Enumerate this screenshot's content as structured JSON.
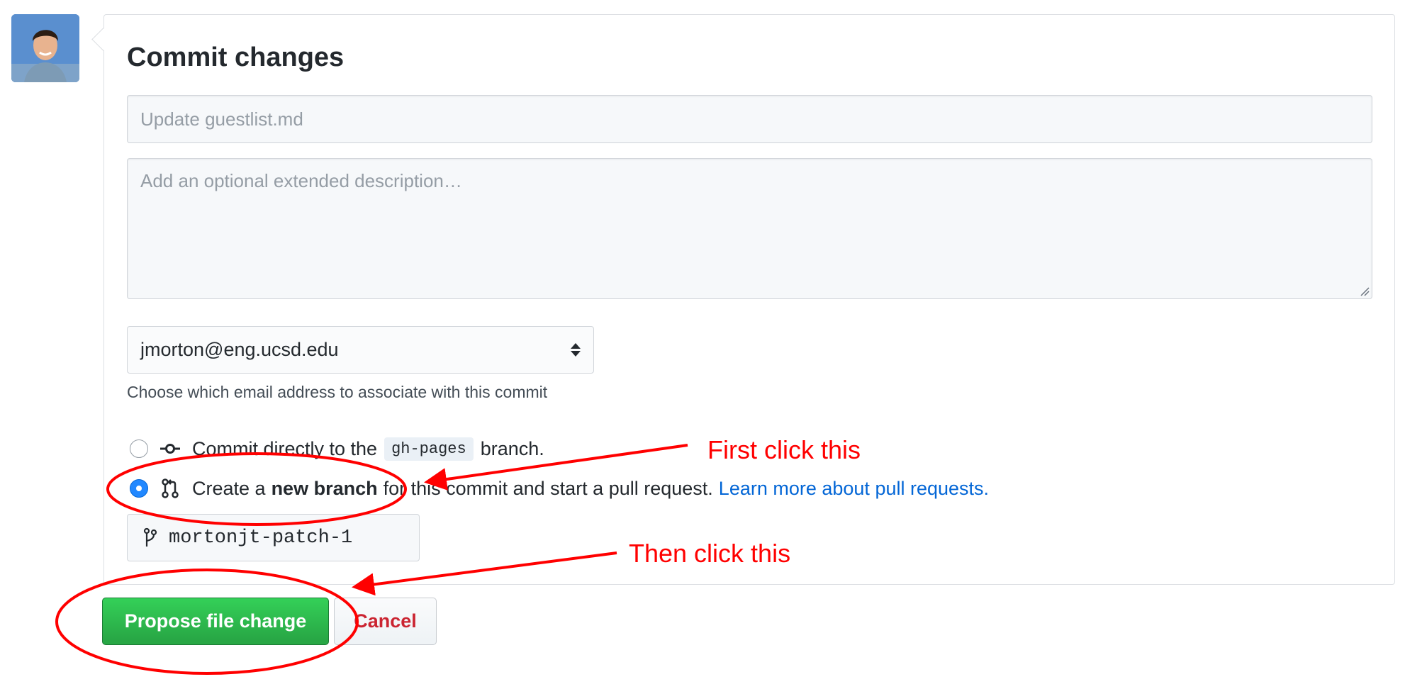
{
  "commit_form": {
    "title": "Commit changes",
    "summary_placeholder": "Update guestlist.md",
    "description_placeholder": "Add an optional extended description…",
    "email_selected": "jmorton@eng.ucsd.edu",
    "email_note": "Choose which email address to associate with this commit",
    "options": {
      "direct": {
        "prefix": "Commit directly to the",
        "branch": "gh-pages",
        "suffix": "branch.",
        "selected": false
      },
      "new_branch": {
        "prefix": "Create a",
        "bold": "new branch",
        "suffix": "for this commit and start a pull request.",
        "link": "Learn more about pull requests.",
        "selected": true
      }
    },
    "branch_name": "mortonjt-patch-1",
    "propose_label": "Propose file change",
    "cancel_label": "Cancel"
  },
  "annotations": {
    "first": "First click this",
    "then": "Then click this",
    "color": "#ff0000"
  },
  "colors": {
    "primary_green": "#28a745",
    "cancel_red": "#cb2431",
    "link_blue": "#0366d6",
    "radio_blue": "#2188ff"
  },
  "icons": {
    "avatar": "user-avatar",
    "commit": "git-commit-icon",
    "pull_request": "git-pull-request-icon",
    "branch": "git-branch-icon",
    "select": "select-arrows-icon"
  }
}
